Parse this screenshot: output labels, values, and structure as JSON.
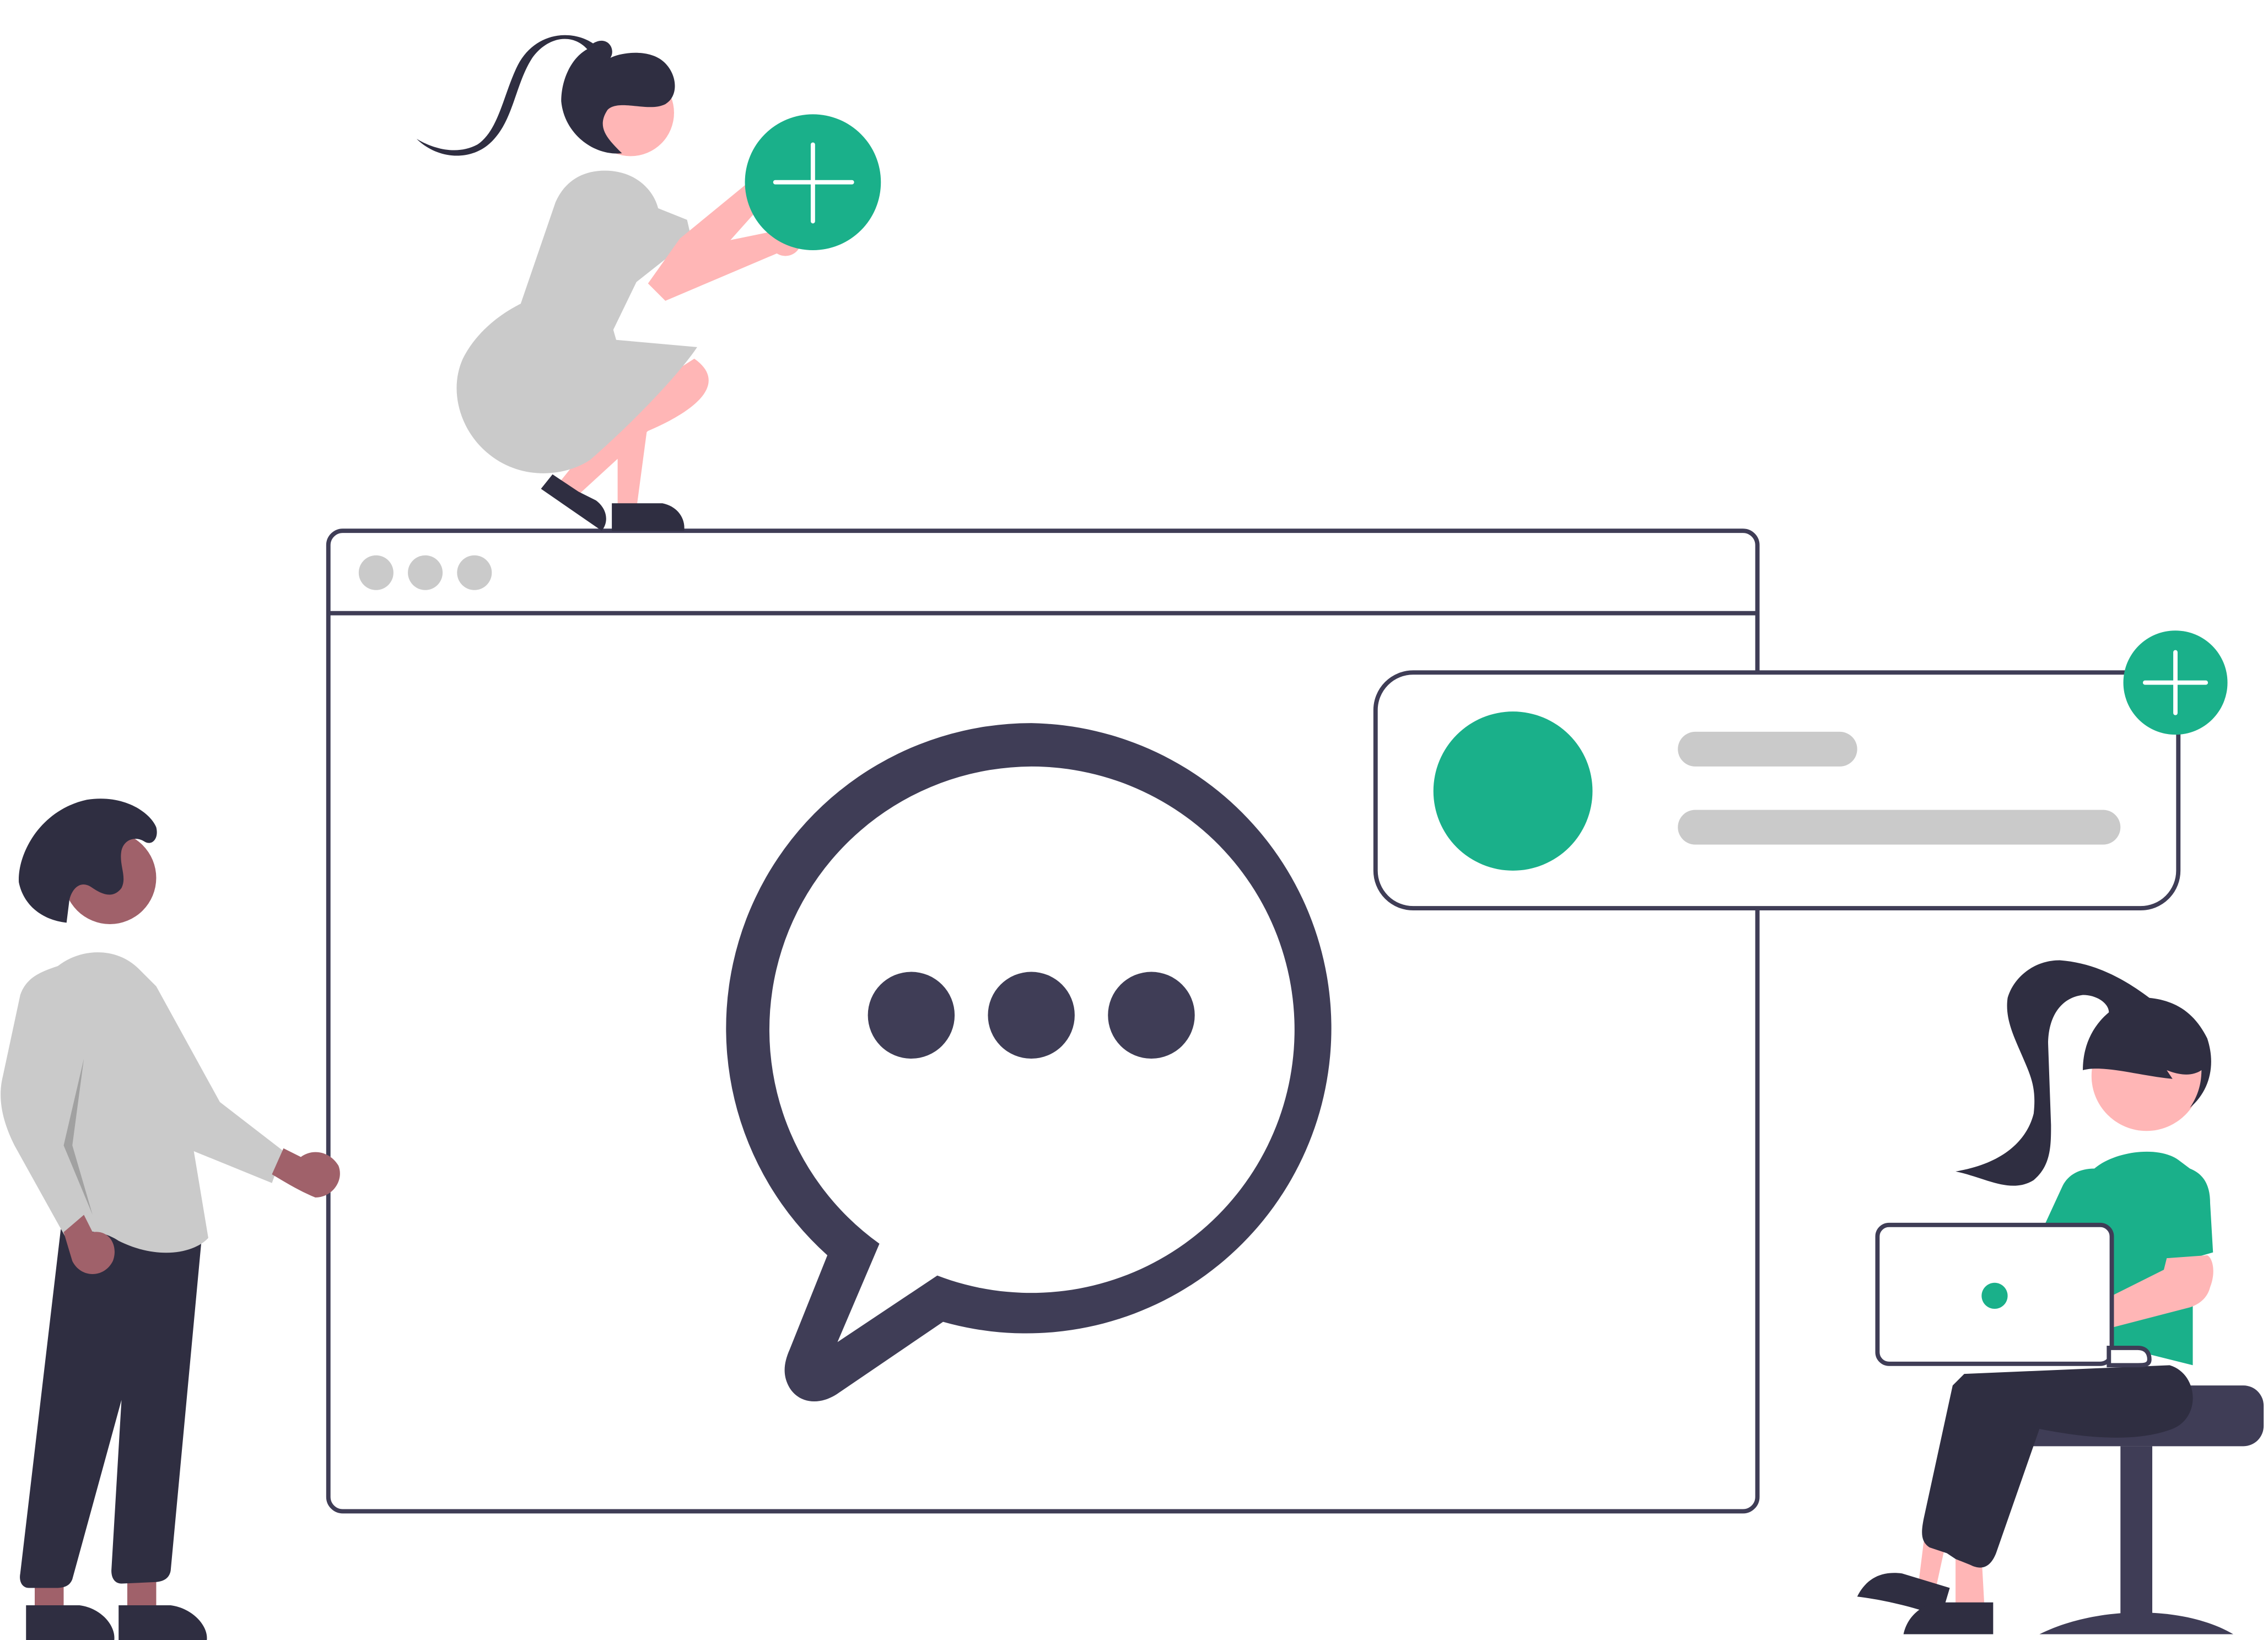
{
  "colors": {
    "outline": "#3f3d56",
    "dark": "#2f2e41",
    "accent": "#1ab08a",
    "skeleton": "#cacaca",
    "skin_light": "#ffb6b6",
    "skin_dark": "#a0616a",
    "shirt": "#cacaca",
    "background": "#ffffff"
  },
  "browser_window": {
    "control_dots": [
      "window-dot-1",
      "window-dot-2",
      "window-dot-3"
    ]
  },
  "chat_bubble": {
    "icon": "speech-bubble-icon",
    "typing_dots": 3
  },
  "notification_card": {
    "avatar": "avatar-circle",
    "text_lines": 2,
    "badge_icon": "plus-icon"
  },
  "floating_badge": {
    "icon": "plus-icon"
  },
  "laptop": {
    "indicator": "camera-dot"
  }
}
